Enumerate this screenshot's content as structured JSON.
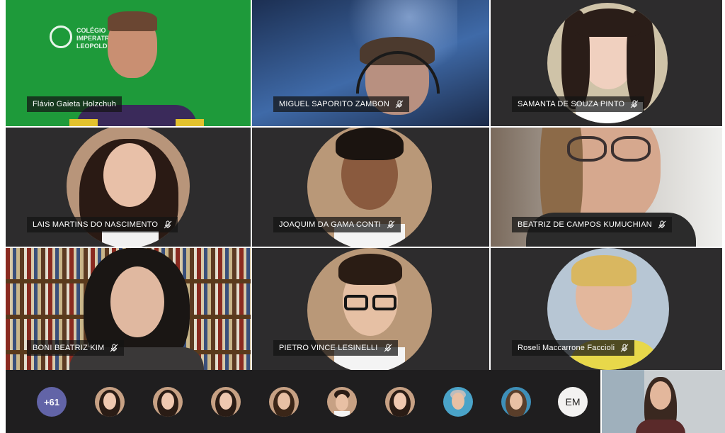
{
  "participants": [
    {
      "name": "Flávio Gaieta Holzchuh",
      "muted": false
    },
    {
      "name": "MIGUEL SAPORITO ZAMBON",
      "muted": true
    },
    {
      "name": "SAMANTA DE SOUZA PINTO",
      "muted": true
    },
    {
      "name": "LAIS MARTINS DO NASCIMENTO",
      "muted": true
    },
    {
      "name": "JOAQUIM DA GAMA CONTI",
      "muted": true
    },
    {
      "name": "BEATRIZ DE CAMPOS KUMUCHIAN",
      "muted": true
    },
    {
      "name": "BONI BEATRIZ KIM",
      "muted": true
    },
    {
      "name": "PIETRO VINCE LESINELLI",
      "muted": true
    },
    {
      "name": "Roseli Maccarrone Faccioli",
      "muted": true
    }
  ],
  "background_logo": {
    "line1": "COLÉGIO",
    "line2": "IMPERATR",
    "line3": "LEOPOLDI"
  },
  "overflow_count": "+61",
  "initials_avatar": "EM",
  "colors": {
    "tile_bg": "#2d2c2d",
    "tray_bg": "#1f1e1f",
    "count_badge": "#6264a7",
    "green_screen": "#1f9a3a"
  }
}
